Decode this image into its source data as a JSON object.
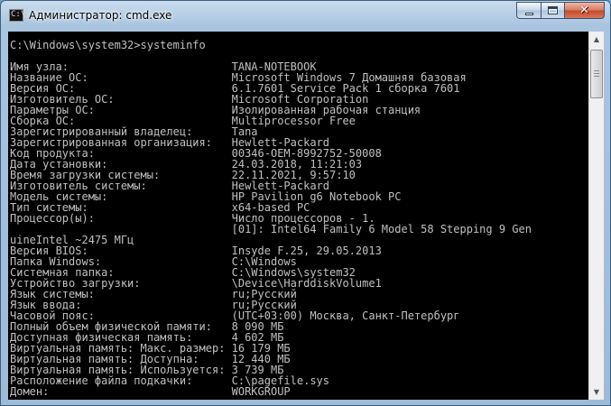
{
  "window": {
    "title": "Администратор: cmd.exe",
    "icon_label": "C:\\",
    "icons": {
      "app": "cmd-icon",
      "minimize": "minimize-icon",
      "maximize": "maximize-icon",
      "close": "close-icon"
    },
    "close_glyph": "✕"
  },
  "colors": {
    "console_background": "#000000",
    "console_text": "#c0c0c0",
    "close_button": "#c44a2c",
    "frame": "#a9c4df"
  },
  "console": {
    "lines": [
      "C:\\Windows\\system32>systeminfo",
      "",
      "Имя узла:                         TANA-NOTEBOOK",
      "Название ОС:                      Microsoft Windows 7 Домашняя базовая",
      "Версия ОС:                        6.1.7601 Service Pack 1 сборка 7601",
      "Изготовитель ОС:                  Microsoft Corporation",
      "Параметры ОС:                     Изолированная рабочая станция",
      "Сборка ОС:                        Multiprocessor Free",
      "Зарегистрированный владелец:      Tana",
      "Зарегистрированная организация:   Hewlett-Packard",
      "Код продукта:                     00346-OEM-8992752-50008",
      "Дата установки:                   24.03.2018, 11:21:03",
      "Время загрузки системы:           22.11.2021, 9:57:10",
      "Изготовитель системы:             Hewlett-Packard",
      "Модель системы:                   HP Pavilion g6 Notebook PC",
      "Тип системы:                      x64-based PC",
      "Процессор(ы):                     Число процессоров - 1.",
      "                                  [01]: Intel64 Family 6 Model 58 Stepping 9 Gen",
      "uineIntel ~2475 МГц",
      "Версия BIOS:                      Insyde F.25, 29.05.2013",
      "Папка Windows:                    C:\\Windows",
      "Системная папка:                  C:\\Windows\\system32",
      "Устройство загрузки:              \\Device\\HarddiskVolume1",
      "Язык системы:                     ru;Русский",
      "Язык ввода:                       ru;Русский",
      "Часовой пояс:                     (UTC+03:00) Москва, Санкт-Петербург",
      "Полный объем физической памяти:   8 090 МБ",
      "Доступная физическая память:      4 602 МБ",
      "Виртуальная память: Макс. размер: 16 179 МБ",
      "Виртуальная память: Доступна:     12 440 МБ",
      "Виртуальная память: Используется: 3 739 МБ",
      "Расположение файла подкачки:      C:\\pagefile.sys",
      "Домен:                            WORKGROUP"
    ]
  },
  "scrollbar": {
    "up_arrow": "▲",
    "down_arrow": "▼",
    "icons": {
      "up": "scroll-up-arrow-icon",
      "down": "scroll-down-arrow-icon"
    }
  }
}
